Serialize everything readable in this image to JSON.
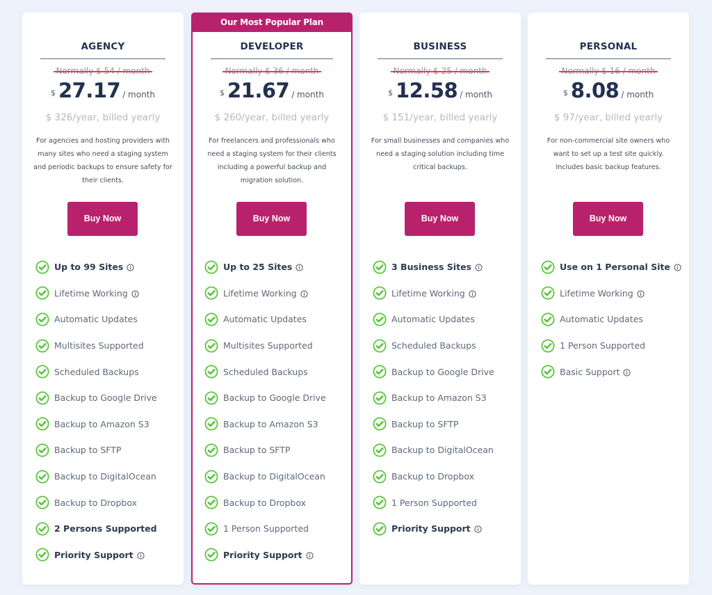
{
  "colors": {
    "accent": "#b8226c",
    "check": "#5ac53a",
    "strike": "#e0424b",
    "heading": "#21324e",
    "background": "#eef2fb"
  },
  "plans": [
    {
      "name": "AGENCY",
      "popular_banner": null,
      "normal_price": "Normally $ 54 / month",
      "currency": "$",
      "price": "27.17",
      "per": "/ month",
      "yearly": "$ 326/year, billed yearly",
      "description": "For agencies and hosting providers with many sites who need a staging system and periodic backups to ensure safety for their clients.",
      "button_label": "Buy Now",
      "features": [
        {
          "label": "Up to 99 Sites",
          "bold": true,
          "info": true
        },
        {
          "label": "Lifetime Working",
          "bold": false,
          "info": true
        },
        {
          "label": "Automatic Updates",
          "bold": false,
          "info": false
        },
        {
          "label": "Multisites Supported",
          "bold": false,
          "info": false
        },
        {
          "label": "Scheduled Backups",
          "bold": false,
          "info": false
        },
        {
          "label": "Backup to Google Drive",
          "bold": false,
          "info": false
        },
        {
          "label": "Backup to Amazon S3",
          "bold": false,
          "info": false
        },
        {
          "label": "Backup to SFTP",
          "bold": false,
          "info": false
        },
        {
          "label": "Backup to DigitalOcean",
          "bold": false,
          "info": false
        },
        {
          "label": "Backup to Dropbox",
          "bold": false,
          "info": false
        },
        {
          "label": "2 Persons Supported",
          "bold": true,
          "info": false
        },
        {
          "label": "Priority Support",
          "bold": true,
          "info": true
        }
      ]
    },
    {
      "name": "DEVELOPER",
      "popular_banner": "Our Most Popular Plan",
      "normal_price": "Normally $ 36 / month",
      "currency": "$",
      "price": "21.67",
      "per": "/ month",
      "yearly": "$ 260/year, billed yearly",
      "description": "For freelancers and professionals who need a staging system for their clients including a powerful backup and migration solution.",
      "button_label": "Buy Now",
      "features": [
        {
          "label": "Up to 25 Sites",
          "bold": true,
          "info": true
        },
        {
          "label": "Lifetime Working",
          "bold": false,
          "info": true
        },
        {
          "label": "Automatic Updates",
          "bold": false,
          "info": false
        },
        {
          "label": "Multisites Supported",
          "bold": false,
          "info": false
        },
        {
          "label": "Scheduled Backups",
          "bold": false,
          "info": false
        },
        {
          "label": "Backup to Google Drive",
          "bold": false,
          "info": false
        },
        {
          "label": "Backup to Amazon S3",
          "bold": false,
          "info": false
        },
        {
          "label": "Backup to SFTP",
          "bold": false,
          "info": false
        },
        {
          "label": "Backup to DigitalOcean",
          "bold": false,
          "info": false
        },
        {
          "label": "Backup to Dropbox",
          "bold": false,
          "info": false
        },
        {
          "label": "1 Person Supported",
          "bold": false,
          "info": false
        },
        {
          "label": "Priority Support",
          "bold": true,
          "info": true
        }
      ]
    },
    {
      "name": "BUSINESS",
      "popular_banner": null,
      "normal_price": "Normally $ 25 / month",
      "currency": "$",
      "price": "12.58",
      "per": "/ month",
      "yearly": "$ 151/year, billed yearly",
      "description": "For small businesses and companies who need a staging solution including time critical backups.",
      "button_label": "Buy Now",
      "features": [
        {
          "label": "3 Business Sites",
          "bold": true,
          "info": true
        },
        {
          "label": "Lifetime Working",
          "bold": false,
          "info": true
        },
        {
          "label": "Automatic Updates",
          "bold": false,
          "info": false
        },
        {
          "label": "Scheduled Backups",
          "bold": false,
          "info": false
        },
        {
          "label": "Backup to Google Drive",
          "bold": false,
          "info": false
        },
        {
          "label": "Backup to Amazon S3",
          "bold": false,
          "info": false
        },
        {
          "label": "Backup to SFTP",
          "bold": false,
          "info": false
        },
        {
          "label": "Backup to DigitalOcean",
          "bold": false,
          "info": false
        },
        {
          "label": "Backup to Dropbox",
          "bold": false,
          "info": false
        },
        {
          "label": "1 Person Supported",
          "bold": false,
          "info": false
        },
        {
          "label": "Priority Support",
          "bold": true,
          "info": true
        }
      ]
    },
    {
      "name": "PERSONAL",
      "popular_banner": null,
      "normal_price": "Normally $ 16 / month",
      "currency": "$",
      "price": "8.08",
      "per": "/ month",
      "yearly": "$ 97/year, billed yearly",
      "description": "For non-commercial site owners who want to set up a test site quickly. Includes basic backup features.",
      "button_label": "Buy Now",
      "features": [
        {
          "label": "Use on 1 Personal Site",
          "bold": true,
          "info": true
        },
        {
          "label": "Lifetime Working",
          "bold": false,
          "info": true
        },
        {
          "label": "Automatic Updates",
          "bold": false,
          "info": false
        },
        {
          "label": "1 Person Supported",
          "bold": false,
          "info": false
        },
        {
          "label": "Basic Support",
          "bold": false,
          "info": true
        }
      ]
    }
  ]
}
